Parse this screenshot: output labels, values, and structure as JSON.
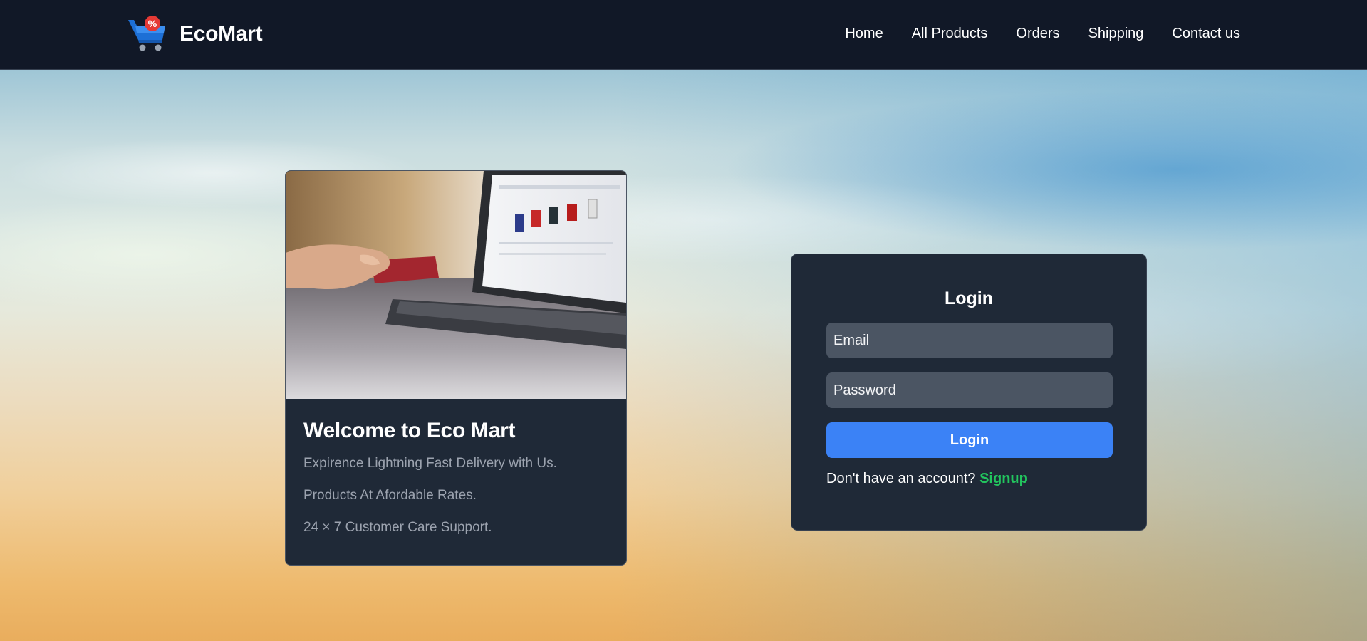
{
  "header": {
    "brand": "EcoMart",
    "logo_icon": "shopping-cart-percent-icon",
    "nav": [
      {
        "label": "Home"
      },
      {
        "label": "All Products"
      },
      {
        "label": "Orders"
      },
      {
        "label": "Shipping"
      },
      {
        "label": "Contact us"
      }
    ]
  },
  "welcome": {
    "image": "hand-holding-credit-card-at-laptop",
    "title": "Welcome to Eco Mart",
    "lines": [
      "Expirence Lightning Fast Delivery with Us.",
      "Products At Afordable Rates.",
      "24 × 7 Customer Care Support."
    ]
  },
  "login": {
    "title": "Login",
    "email_placeholder": "Email",
    "password_placeholder": "Password",
    "button_label": "Login",
    "signup_prompt": "Don't have an account?",
    "signup_link": "Signup"
  },
  "colors": {
    "header_bg": "#111827",
    "card_bg": "#1f2937",
    "input_bg": "#4b5563",
    "primary": "#3b82f6",
    "signup_link": "#22c55e",
    "muted_text": "#9ca3af"
  }
}
